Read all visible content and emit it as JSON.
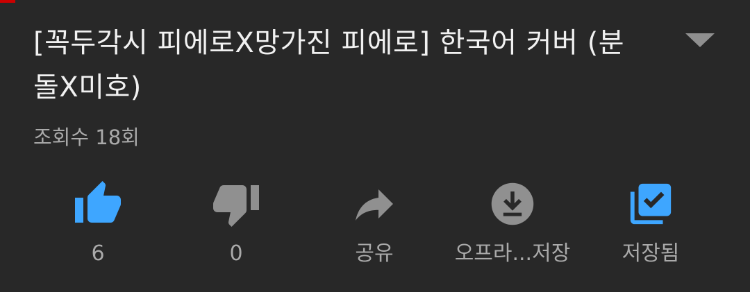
{
  "video": {
    "title": "[꼭두각시 피에로X망가진 피에로] 한국어 커버 (분돌X미호)",
    "views": "조회수 18회"
  },
  "actions": {
    "like": {
      "label": "6",
      "icon": "thumbs-up-icon",
      "active": true
    },
    "dislike": {
      "label": "0",
      "icon": "thumbs-down-icon"
    },
    "share": {
      "label": "공유",
      "icon": "share-arrow-icon"
    },
    "download": {
      "label": "오프라...저장",
      "icon": "download-icon"
    },
    "save": {
      "label": "저장됨",
      "icon": "playlist-saved-icon",
      "active": true
    }
  },
  "colors": {
    "background": "#282828",
    "title_text": "#f1f1f1",
    "secondary_text": "#aaaaaa",
    "accent": "#3ea6ff",
    "icon_grey": "#909090",
    "top_mark": "#cc0000"
  },
  "expand_icon": "chevron-down-icon"
}
